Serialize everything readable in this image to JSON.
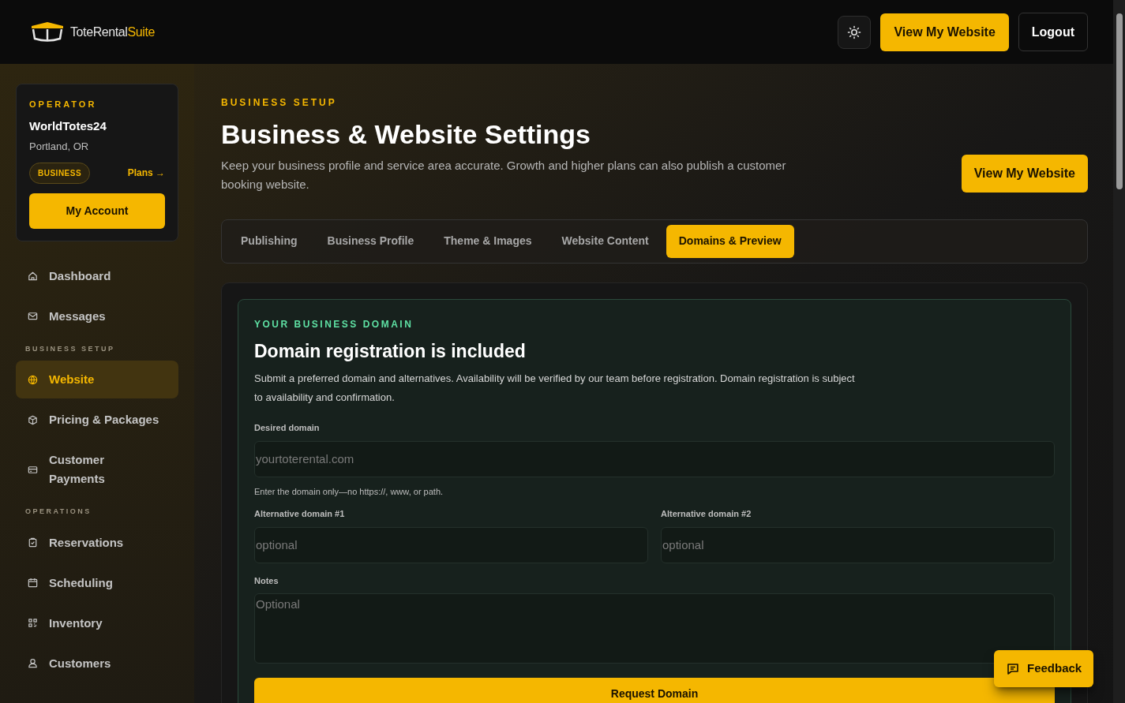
{
  "header": {
    "logo": {
      "primary": "ToteRental",
      "accent": "Suite"
    },
    "buttons": {
      "primary": "View My Website",
      "secondary": "Logout"
    }
  },
  "operator": {
    "eyebrow": "OPERATOR",
    "name": "WorldTotes24",
    "location": "Portland, OR",
    "plan_badge": "BUSINESS",
    "plans_link": "Plans →",
    "account_button": "My Account"
  },
  "sidebar": {
    "items": [
      {
        "kind": "item",
        "label": "Dashboard",
        "selected": false
      },
      {
        "kind": "item",
        "label": "Messages",
        "selected": false
      },
      {
        "kind": "section",
        "label": "BUSINESS SETUP"
      },
      {
        "kind": "item",
        "label": "Website",
        "selected": true
      },
      {
        "kind": "item",
        "label": "Pricing & Packages",
        "selected": false
      },
      {
        "kind": "item",
        "label": "Customer Payments",
        "selected": false
      },
      {
        "kind": "section",
        "label": "OPERATIONS"
      },
      {
        "kind": "item",
        "label": "Reservations",
        "selected": false
      },
      {
        "kind": "item",
        "label": "Scheduling",
        "selected": false
      },
      {
        "kind": "item",
        "label": "Inventory",
        "selected": false
      },
      {
        "kind": "item",
        "label": "Customers",
        "selected": false
      }
    ]
  },
  "page": {
    "eyebrow": "BUSINESS SETUP",
    "title": "Business & Website Settings",
    "description": "Keep your business profile and service area accurate. Growth and higher plans can also publish a customer booking website.",
    "action_button": "View My Website"
  },
  "tabs": [
    {
      "label": "Publishing",
      "selected": false
    },
    {
      "label": "Business Profile",
      "selected": false
    },
    {
      "label": "Theme & Images",
      "selected": false
    },
    {
      "label": "Website Content",
      "selected": false
    },
    {
      "label": "Domains & Preview",
      "selected": true
    }
  ],
  "domain_card": {
    "eyebrow": "YOUR BUSINESS DOMAIN",
    "title": "Domain registration is included",
    "description": "Submit a preferred domain and alternatives. Availability will be verified by our team before registration. Domain registration is subject to availability and confirmation.",
    "desired": {
      "label": "Desired domain",
      "placeholder": "yourtoterental.com",
      "hint": "Enter the domain only—no https://, www, or path."
    },
    "alternatives": [
      {
        "label": "Alternative domain #1",
        "placeholder": "optional"
      },
      {
        "label": "Alternative domain #2",
        "placeholder": "optional"
      }
    ],
    "notes": {
      "label": "Notes",
      "placeholder": "Optional"
    },
    "submit_button": "Request Domain"
  },
  "feedback_button": "Feedback"
}
